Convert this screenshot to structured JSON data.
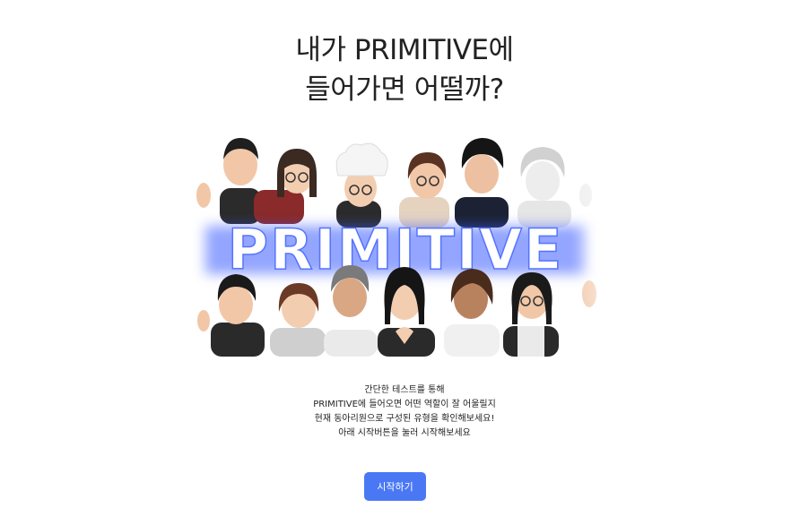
{
  "title": {
    "line1": "내가 PRIMITIVE에",
    "line2": "들어가면 어떨까?"
  },
  "hero": {
    "wordmark": "PRIMITIVE",
    "colors": {
      "glow": "#3b5bff",
      "letters": "#ffffff"
    }
  },
  "description": {
    "lines": [
      "간단한 테스트를 통해",
      "PRIMITIVE에 들어오면 어떤 역할이 잘 어울릴지",
      "현재 동아리원으로 구성된 유형을 확인해보세요!",
      "아래 시작버튼을 눌러 시작해보세요"
    ]
  },
  "start_button": {
    "label": "시작하기",
    "color": "#4a78f5"
  }
}
